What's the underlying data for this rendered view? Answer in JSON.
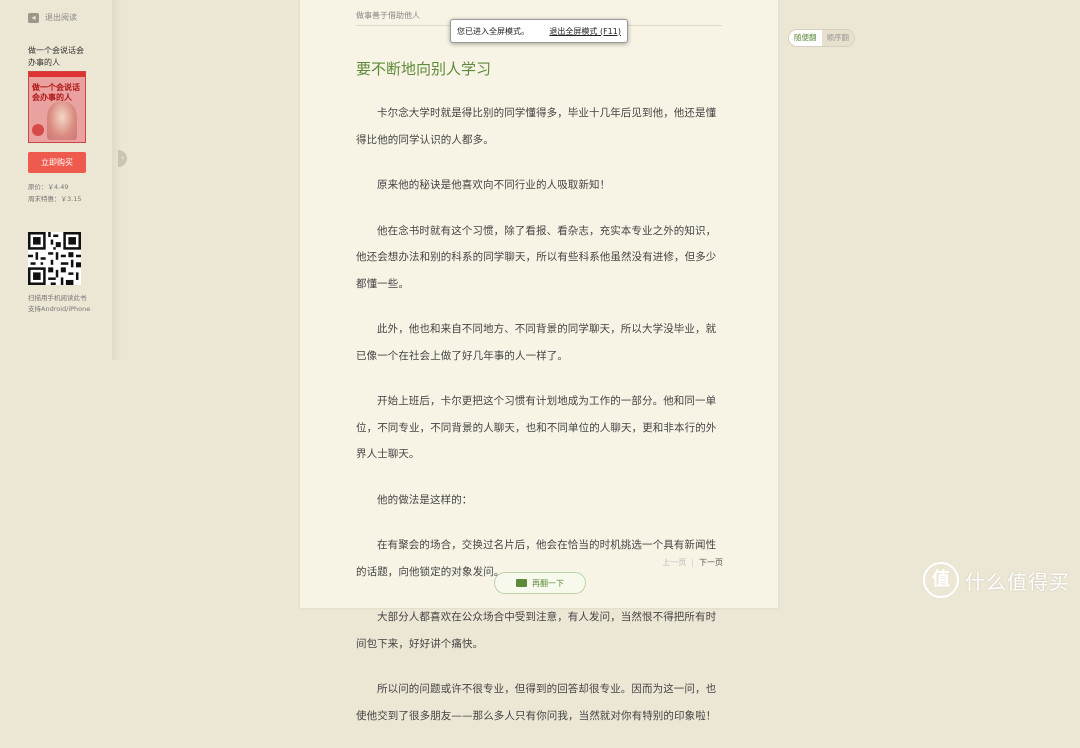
{
  "sidebar": {
    "exit_label": "退出阅读",
    "book_title": "做一个会说话会办事的人",
    "cover_text": "做一个会说话会办事的人",
    "buy_label": "立即购买",
    "original_price": "原价：￥4.49",
    "weekend_price": "周末特惠：￥3.15",
    "qr_caption_1": "扫描用手机阅读此书",
    "qr_caption_2": "支持Android/iPhone"
  },
  "page": {
    "header": "做事善于借助他人",
    "title": "要不断地向别人学习",
    "paragraphs": [
      "卡尔念大学时就是得比别的同学懂得多，毕业十几年后见到他，他还是懂得比他的同学认识的人都多。",
      "原来他的秘诀是他喜欢向不同行业的人吸取新知！",
      "他在念书时就有这个习惯，除了看报、看杂志，充实本专业之外的知识，他还会想办法和别的科系的同学聊天，所以有些科系他虽然没有进修，但多少都懂一些。",
      "此外，他也和来自不同地方、不同背景的同学聊天，所以大学没毕业，就已像一个在社会上做了好几年事的人一样了。",
      "开始上班后，卡尔更把这个习惯有计划地成为工作的一部分。他和同一单位，不同专业，不同背景的人聊天，也和不同单位的人聊天，更和非本行的外界人士聊天。",
      "他的做法是这样的：",
      "在有聚会的场合，交换过名片后，他会在恰当的时机挑选一个具有新闻性的话题，向他锁定的对象发问。",
      "大部分人都喜欢在公众场合中受到注意，有人发问，当然恨不得把所有时间包下来，好好讲个痛快。",
      "所以问的问题或许不很专业，但得到的回答却很专业。因而为这一问，也使他交到了很多朋友——那么多人只有你问我，当然就对你有特别的印象啦！"
    ],
    "prev_label": "上一页",
    "next_label": "下一页",
    "again_label": "再翻一下"
  },
  "fullscreen_notice": {
    "message": "您已进入全屏模式。",
    "exit_label": "退出全屏模式 (F11)"
  },
  "mode_toggle": {
    "active": "随便翻",
    "inactive": "顺序翻"
  },
  "watermark": {
    "logo": "值",
    "text": "什么值得买"
  },
  "colors": {
    "accent_green": "#5d8a3a",
    "buy_red": "#ef5a4f",
    "page_bg": "#f8f4e5",
    "app_bg": "#ece6d4"
  }
}
